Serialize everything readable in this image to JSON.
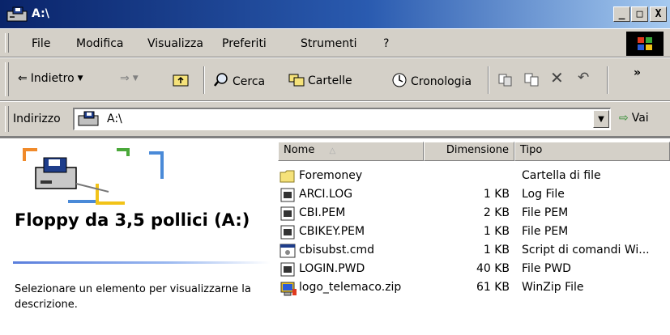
{
  "window": {
    "title": "A:\\",
    "buttons": {
      "minimize": "_",
      "maximize": "□",
      "close": "X"
    }
  },
  "menu": [
    "File",
    "Modifica",
    "Visualizza",
    "Preferiti",
    "Strumenti",
    "?"
  ],
  "toolbar": {
    "back": "Indietro",
    "search": "Cerca",
    "folders": "Cartelle",
    "history": "Cronologia",
    "more": "»"
  },
  "address": {
    "label": "Indirizzo",
    "value": "A:\\",
    "go": "Vai"
  },
  "leftpane": {
    "drive_title": "Floppy da 3,5 pollici (A:)",
    "description": "Selezionare un elemento per visualizzarne la descrizione."
  },
  "columns": {
    "name": "Nome",
    "size": "Dimensione",
    "type": "Tipo"
  },
  "files": [
    {
      "name": "Foremoney",
      "size": "",
      "type": "Cartella di file",
      "icon": "folder-icon"
    },
    {
      "name": "ARCI.LOG",
      "size": "1 KB",
      "type": "Log File",
      "icon": "file-icon"
    },
    {
      "name": "CBI.PEM",
      "size": "2 KB",
      "type": "File PEM",
      "icon": "file-icon"
    },
    {
      "name": "CBIKEY.PEM",
      "size": "1 KB",
      "type": "File PEM",
      "icon": "file-icon"
    },
    {
      "name": "cbisubst.cmd",
      "size": "1 KB",
      "type": "Script di comandi Wi...",
      "icon": "script-icon"
    },
    {
      "name": "LOGIN.PWD",
      "size": "40 KB",
      "type": "File PWD",
      "icon": "file-icon"
    },
    {
      "name": "logo_telemaco.zip",
      "size": "61 KB",
      "type": "WinZip File",
      "icon": "winzip-icon"
    }
  ]
}
